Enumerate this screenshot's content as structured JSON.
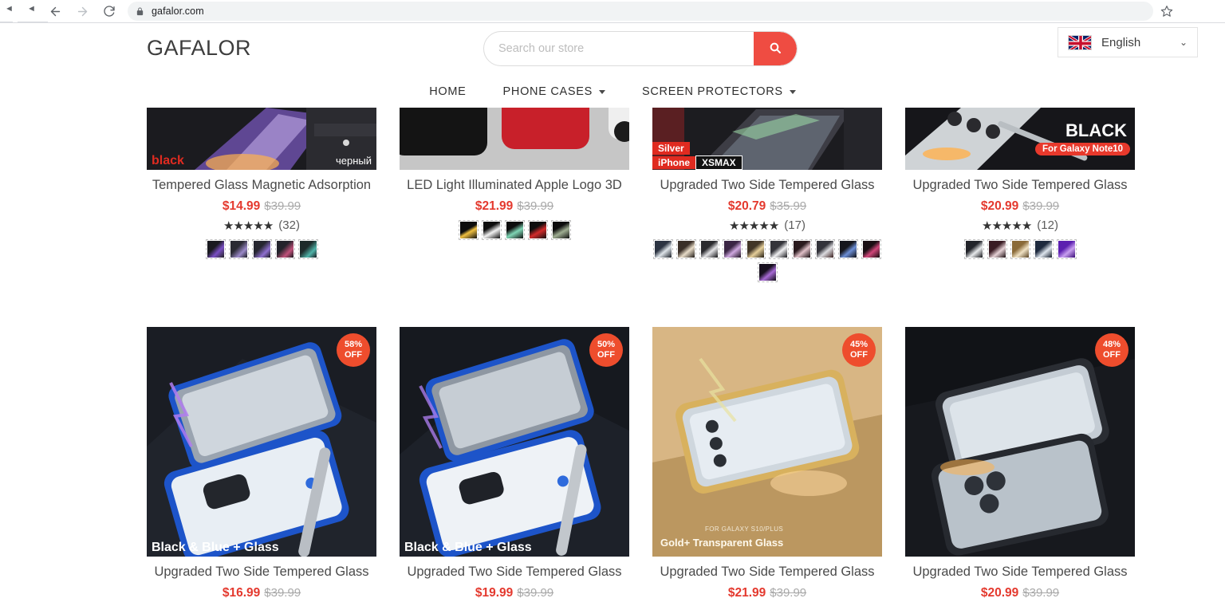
{
  "browser": {
    "url": "gafalor.com",
    "back_label": "Back",
    "forward_label": "Forward",
    "reload_label": "Reload",
    "bookmark_label": "Bookmark this tab",
    "lock_icon": "lock-icon",
    "star_icon": "star-icon",
    "tab_scroll_left_icon": "chevron-left-icon"
  },
  "header": {
    "brand": "GAFALOR",
    "search": {
      "placeholder": "Search our store",
      "value": "",
      "button_icon": "search-icon"
    },
    "language": {
      "label": "English",
      "flag_icon": "uk-flag-icon",
      "caret_icon": "chevron-down-icon"
    }
  },
  "nav": {
    "items": [
      {
        "label": "HOME",
        "has_dropdown": false
      },
      {
        "label": "PHONE CASES",
        "has_dropdown": true
      },
      {
        "label": "SCREEN PROTECTORS",
        "has_dropdown": true
      }
    ]
  },
  "colors": {
    "accent": "#ef4c42",
    "sale_price": "#e4392e",
    "old_price": "#a9a9a9",
    "badge": "#ee4d2d",
    "title": "#4a4a4a"
  },
  "products": {
    "row1": [
      {
        "title": "Tempered Glass Magnetic Adsorption",
        "sale_price": "$14.99",
        "old_price": "$39.99",
        "rating": "★★★★★",
        "rating_count": "(32)",
        "image_caption_left": "black",
        "image_caption_right": "черный",
        "swatch_count": 5
      },
      {
        "title": "LED Light Illuminated Apple Logo 3D",
        "sale_price": "$21.99",
        "old_price": "$39.99",
        "rating": "",
        "rating_count": "",
        "swatch_count": 5
      },
      {
        "title": "Upgraded Two Side Tempered Glass",
        "sale_price": "$20.79",
        "old_price": "$35.99",
        "rating": "★★★★★",
        "rating_count": "(17)",
        "image_caption_color": "Silver",
        "image_caption_model_prefix": "iPhone",
        "image_caption_model": "XSMAX",
        "swatch_count": 11
      },
      {
        "title": "Upgraded Two Side Tempered Glass",
        "sale_price": "$20.99",
        "old_price": "$39.99",
        "rating": "★★★★★",
        "rating_count": "(12)",
        "image_caption_big": "BLACK",
        "image_caption_pill": "For Galaxy Note10",
        "swatch_count": 5
      }
    ],
    "row2": [
      {
        "title": "Upgraded Two Side Tempered Glass",
        "sale_price": "$16.99",
        "old_price": "$39.99",
        "badge_percent": "58%",
        "badge_off": "OFF",
        "image_caption": "Black & Blue + Glass"
      },
      {
        "title": "Upgraded Two Side Tempered Glass",
        "sale_price": "$19.99",
        "old_price": "$39.99",
        "badge_percent": "50%",
        "badge_off": "OFF",
        "image_caption": "Black & Blue + Glass"
      },
      {
        "title": "Upgraded Two Side Tempered Glass",
        "sale_price": "$21.99",
        "old_price": "$39.99",
        "badge_percent": "45%",
        "badge_off": "OFF",
        "image_caption_overline": "FOR GALAXY S10/PLUS",
        "image_caption": "Gold+ Transparent Glass"
      },
      {
        "title": "Upgraded Two Side Tempered Glass",
        "sale_price": "$20.99",
        "old_price": "$39.99",
        "badge_percent": "48%",
        "badge_off": "OFF",
        "image_caption": ""
      }
    ]
  }
}
